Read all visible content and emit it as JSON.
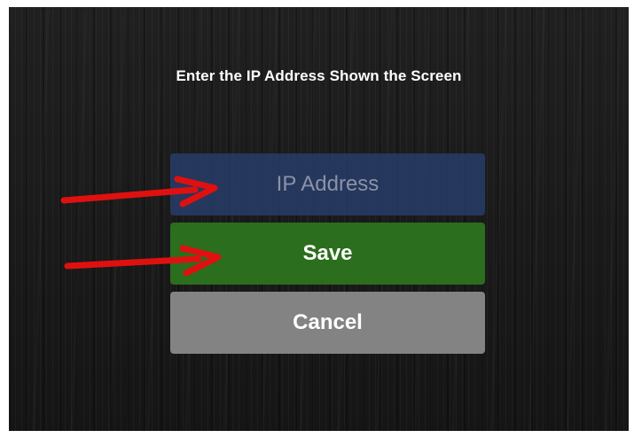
{
  "prompt": {
    "text": "Enter the IP Address Shown the Screen"
  },
  "ip_field": {
    "value": "",
    "placeholder": "IP Address"
  },
  "buttons": {
    "save_label": "Save",
    "cancel_label": "Cancel"
  },
  "colors": {
    "background": "#1a1a1a",
    "input_bg": "#283c69",
    "save_bg": "#2b6e1d",
    "cancel_bg": "#838383",
    "annotation_arrow": "#e01010"
  },
  "annotations": {
    "arrow_icon": "red-arrow-right-icon"
  }
}
